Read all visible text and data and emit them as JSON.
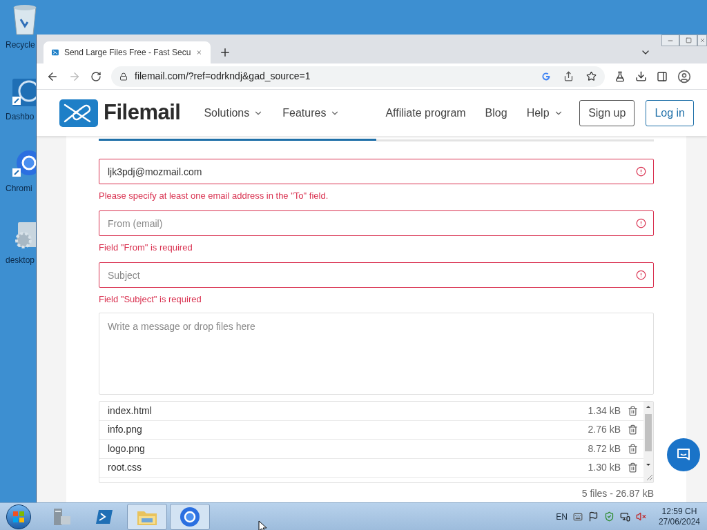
{
  "desktop_icons": [
    {
      "kind": "recycle-bin",
      "label": "Recycle"
    },
    {
      "kind": "dashboard",
      "label": "Dashbo"
    },
    {
      "kind": "chromium",
      "label": "Chromi"
    },
    {
      "kind": "settings",
      "label": "desktop"
    }
  ],
  "browser": {
    "tab_title": "Send Large Files Free - Fast Secu",
    "url": "filemail.com/?ref=odrkndj&gad_source=1",
    "forward_disabled": true
  },
  "site": {
    "brand": "Filemail",
    "nav": [
      {
        "label": "Solutions",
        "dropdown": true
      },
      {
        "label": "Features",
        "dropdown": true
      },
      {
        "label": "Affiliate program",
        "dropdown": false
      },
      {
        "label": "Blog",
        "dropdown": false
      },
      {
        "label": "Help",
        "dropdown": true
      }
    ],
    "sign_up": "Sign up",
    "log_in": "Log in"
  },
  "form": {
    "tabs": [
      {
        "selected": true
      },
      {
        "selected": false
      }
    ],
    "fields": [
      {
        "value": "ljk3pdj@mozmail.com",
        "invalid": true,
        "error": "Please specify at least one email address in the \"To\" field."
      },
      {
        "placeholder": "From (email)",
        "invalid": true,
        "error": "Field \"From\" is required"
      },
      {
        "placeholder": "Subject",
        "invalid": true,
        "error": "Field \"Subject\" is required"
      }
    ],
    "message": {
      "placeholder": "Write a message or drop files here"
    },
    "files": [
      {
        "name": "index.html",
        "size": "1.34 kB"
      },
      {
        "name": "info.png",
        "size": "2.76 kB"
      },
      {
        "name": "logo.png",
        "size": "8.72 kB"
      },
      {
        "name": "root.css",
        "size": "1.30 kB"
      }
    ],
    "summary": "5 files - 26.87 kB"
  },
  "taskbar": {
    "apps": [
      {
        "kind": "server-manager",
        "active": false
      },
      {
        "kind": "powershell",
        "active": false
      },
      {
        "kind": "explorer",
        "active": true
      },
      {
        "kind": "chromium",
        "active": true
      }
    ],
    "language": "EN",
    "time": "12:59 CH",
    "date": "27/06/2024"
  }
}
